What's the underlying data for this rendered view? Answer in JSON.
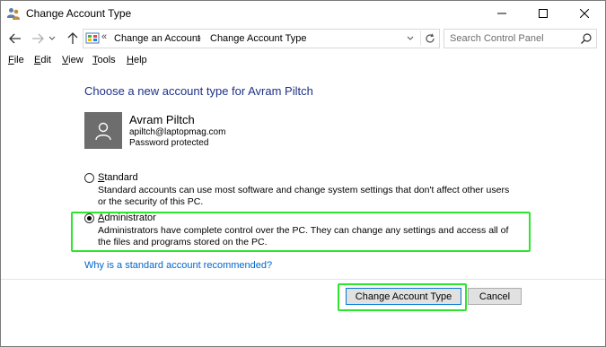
{
  "window": {
    "title": "Change Account Type",
    "title_icon": "user-accounts-icon",
    "controls": [
      "minimize-icon",
      "maximize-icon",
      "close-icon"
    ]
  },
  "navigation": {
    "back_icon": "back-arrow-icon",
    "forward_icon": "forward-arrow-icon",
    "recent_icon": "chevron-down-icon",
    "up_icon": "up-arrow-icon"
  },
  "address": {
    "separator": "«",
    "crumbs": [
      "Change an Account",
      "Change Account Type"
    ],
    "refresh_icon": "refresh-icon"
  },
  "search": {
    "placeholder": "Search Control Panel",
    "value": ""
  },
  "menu": {
    "items": [
      {
        "key": "F",
        "rest": "ile"
      },
      {
        "key": "E",
        "rest": "dit"
      },
      {
        "key": "V",
        "rest": "iew"
      },
      {
        "key": "T",
        "rest": "ools"
      },
      {
        "key": "H",
        "rest": "elp"
      }
    ]
  },
  "page": {
    "heading": "Choose a new account type for Avram Piltch",
    "user": {
      "name": "Avram Piltch",
      "email": "apiltch@laptopmag.com",
      "status": "Password protected"
    },
    "options": {
      "standard": {
        "key": "S",
        "rest": "tandard",
        "description": "Standard accounts can use most software and change system settings that don't affect other users or the security of this PC.",
        "checked": false
      },
      "administrator": {
        "key": "A",
        "rest": "dministrator",
        "description": "Administrators have complete control over the PC. They can change any settings and access all of the files and programs stored on the PC.",
        "checked": true
      }
    },
    "help_link": "Why is a standard account recommended?",
    "buttons": {
      "change": "Change Account Type",
      "cancel": "Cancel"
    }
  },
  "colors": {
    "heading": "#1e3287",
    "link": "#0066cc",
    "highlight": "#2ee52e",
    "avatar_bg": "#6d6d6d"
  }
}
